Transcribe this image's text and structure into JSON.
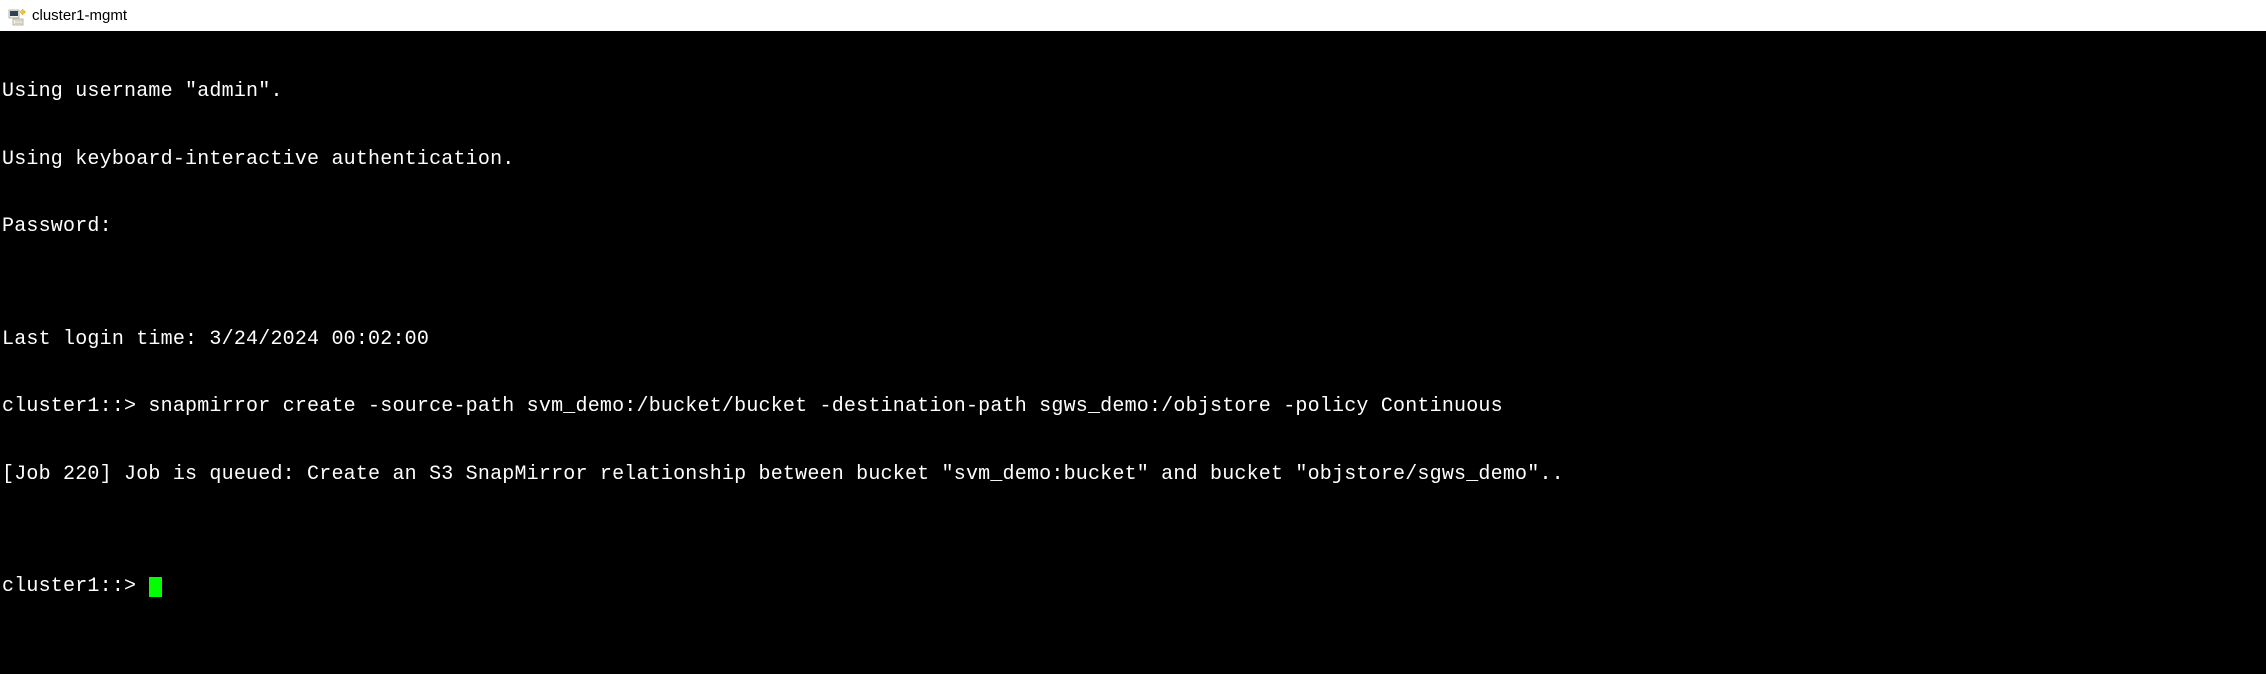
{
  "window": {
    "title": "cluster1-mgmt"
  },
  "terminal": {
    "lines": [
      "Using username \"admin\".",
      "Using keyboard-interactive authentication.",
      "Password:",
      "",
      "Last login time: 3/24/2024 00:02:00",
      "cluster1::> snapmirror create -source-path svm_demo:/bucket/bucket -destination-path sgws_demo:/objstore -policy Continuous",
      "[Job 220] Job is queued: Create an S3 SnapMirror relationship between bucket \"svm_demo:bucket\" and bucket \"objstore/sgws_demo\"..",
      ""
    ],
    "current_prompt": "cluster1::> "
  }
}
